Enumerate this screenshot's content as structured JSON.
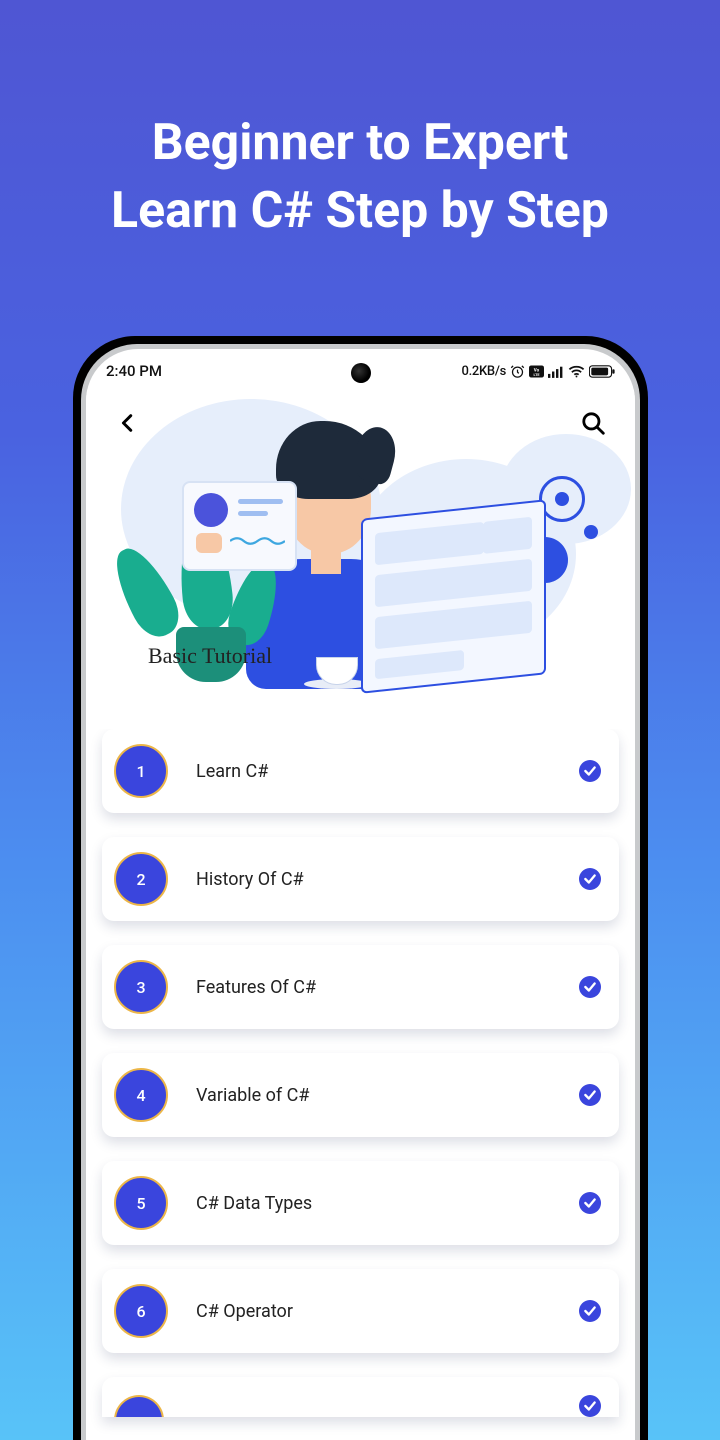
{
  "promo": {
    "line1": "Beginner to Expert",
    "line2": "Learn C# Step by Step"
  },
  "statusbar": {
    "time": "2:40 PM",
    "net_speed": "0.2KB/s"
  },
  "hero": {
    "title": "Basic Tutorial"
  },
  "lessons": [
    {
      "index": "1",
      "title": "Learn C#",
      "completed": true
    },
    {
      "index": "2",
      "title": "History Of C#",
      "completed": true
    },
    {
      "index": "3",
      "title": "Features Of C#",
      "completed": true
    },
    {
      "index": "4",
      "title": "Variable of C#",
      "completed": true
    },
    {
      "index": "5",
      "title": "C# Data Types",
      "completed": true
    },
    {
      "index": "6",
      "title": "C# Operator",
      "completed": true
    }
  ],
  "colors": {
    "accent": "#3a45dd",
    "accent_border": "#ecb648"
  }
}
